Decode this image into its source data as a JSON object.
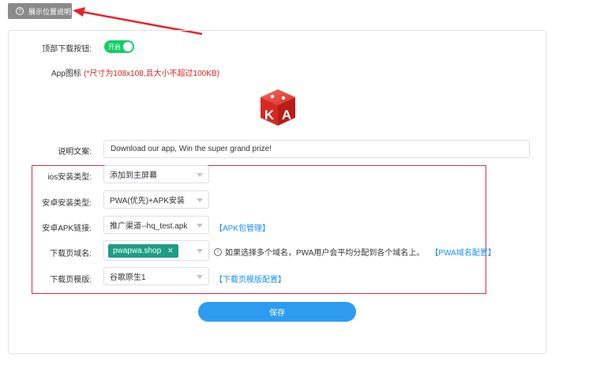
{
  "help_button": {
    "label": "展示位置说明",
    "icon": "question-circle-icon"
  },
  "form": {
    "top_download": {
      "label": "顶部下载按钮:",
      "toggle_label": "开启",
      "enabled": true
    },
    "app_icon": {
      "label": "App图标",
      "hint": "(*尺寸为108x108,且大小不超过100KB)",
      "icon_letters": "KA"
    },
    "description": {
      "label": "说明文案:",
      "value": "Download our app, Win the super grand prize!"
    },
    "ios_install": {
      "label": "ios安装类型:",
      "value": "添加到主屏幕"
    },
    "android_install": {
      "label": "安卓安装类型:",
      "value": "PWA(优先)+APK安装"
    },
    "android_apk": {
      "label": "安卓APK链接:",
      "value": "推广渠道--hq_test.apk",
      "link": "【APK包管理】"
    },
    "download_domain": {
      "label": "下载页域名:",
      "tags": [
        "pwapwa.shop"
      ],
      "info": "如果选择多个域名，PWA用户会平均分配到各个域名上。",
      "link": "【PWA域名配置】"
    },
    "download_template": {
      "label": "下载页模版:",
      "value": "谷歌原生1",
      "link": "【下载页模版配置】"
    },
    "save_label": "保存"
  },
  "colors": {
    "toggle_on": "#13ce66",
    "save_button": "#2d9cf0",
    "link": "#1890ff",
    "highlight_border": "#d9304a",
    "tag": "#1e9e84",
    "annotation_arrow": "#e8232b"
  }
}
